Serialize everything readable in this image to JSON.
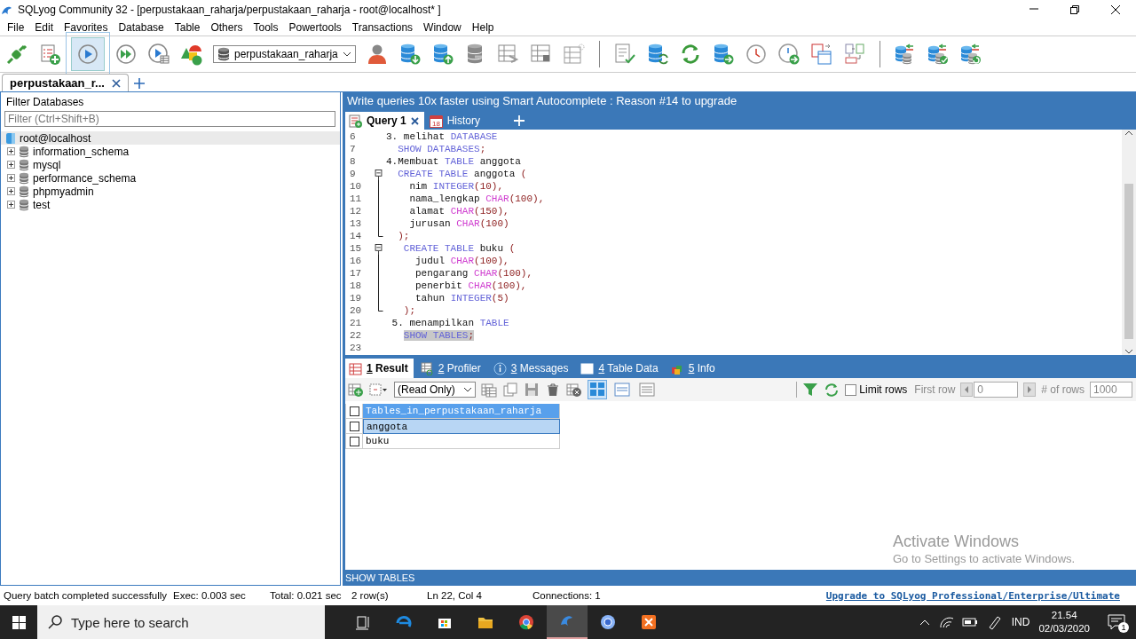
{
  "window": {
    "title": "SQLyog Community 32 - [perpustakaan_raharja/perpustakaan_raharja - root@localhost* ]"
  },
  "menu": [
    "File",
    "Edit",
    "Favorites",
    "Database",
    "Table",
    "Others",
    "Tools",
    "Powertools",
    "Transactions",
    "Window",
    "Help"
  ],
  "toolbar": {
    "database": "perpustakaan_raharja"
  },
  "connection_tabs": [
    {
      "label": "perpustakaan_r...",
      "selected": true
    }
  ],
  "explorer": {
    "title": "Filter Databases",
    "filter": {
      "placeholder": "Filter (Ctrl+Shift+B)"
    },
    "tree": [
      {
        "label": "root@localhost",
        "selected": true,
        "children": [
          {
            "label": "information_schema",
            "expanded": false,
            "selected": false
          },
          {
            "label": "mysql",
            "expanded": false,
            "selected": false
          },
          {
            "label": "performance_schema",
            "expanded": false,
            "selected": false
          },
          {
            "label": "phpmyadmin",
            "expanded": false,
            "selected": false
          },
          {
            "label": "test",
            "expanded": false,
            "selected": false
          }
        ]
      }
    ]
  },
  "banner": "Write queries 10x faster using Smart Autocomplete : Reason #14 to upgrade",
  "query_tabs": [
    {
      "label": "Query 1",
      "selected": true,
      "closable": true
    },
    {
      "label": "History",
      "selected": false,
      "closable": false,
      "icon_text": "18"
    }
  ],
  "editor": {
    "lines": [
      {
        "number": "6",
        "tokens": [
          {
            "kind": "plain",
            "text": "3. melihat "
          },
          {
            "kind": "keyword",
            "text": "DATABASE"
          }
        ]
      },
      {
        "number": "7",
        "tokens": [
          {
            "kind": "keyword",
            "text": "  SHOW DATABASES"
          },
          {
            "kind": "punct",
            "text": ";"
          }
        ]
      },
      {
        "number": "8",
        "tokens": [
          {
            "kind": "plain",
            "text": "4.Membuat "
          },
          {
            "kind": "keyword",
            "text": "TABLE"
          },
          {
            "kind": "plain",
            "text": " anggota"
          }
        ]
      },
      {
        "number": "9",
        "kind": "opener",
        "tokens": [
          {
            "kind": "keyword",
            "text": "  CREATE TABLE"
          },
          {
            "kind": "plain",
            "text": " anggota "
          },
          {
            "kind": "punct",
            "text": "("
          }
        ]
      },
      {
        "number": "10",
        "kind": "inner",
        "tokens": [
          {
            "kind": "plain",
            "text": "    nim "
          },
          {
            "kind": "keyword",
            "text": "INTEGER"
          },
          {
            "kind": "punct",
            "text": "(10),"
          }
        ]
      },
      {
        "number": "11",
        "kind": "inner",
        "tokens": [
          {
            "kind": "plain",
            "text": "    nama_lengkap "
          },
          {
            "kind": "type",
            "text": "CHAR"
          },
          {
            "kind": "punct",
            "text": "(100),"
          }
        ]
      },
      {
        "number": "12",
        "kind": "inner",
        "tokens": [
          {
            "kind": "plain",
            "text": "    alamat "
          },
          {
            "kind": "type",
            "text": "CHAR"
          },
          {
            "kind": "punct",
            "text": "(150),"
          }
        ]
      },
      {
        "number": "13",
        "kind": "inner",
        "tokens": [
          {
            "kind": "plain",
            "text": "    jurusan "
          },
          {
            "kind": "type",
            "text": "CHAR"
          },
          {
            "kind": "punct",
            "text": "(100)"
          }
        ]
      },
      {
        "number": "14",
        "kind": "closer",
        "tokens": [
          {
            "kind": "punct",
            "text": "  );"
          }
        ]
      },
      {
        "number": "15",
        "kind": "opener",
        "tokens": [
          {
            "kind": "keyword",
            "text": "   CREATE TABLE"
          },
          {
            "kind": "plain",
            "text": " buku "
          },
          {
            "kind": "punct",
            "text": "("
          }
        ]
      },
      {
        "number": "16",
        "kind": "inner",
        "tokens": [
          {
            "kind": "plain",
            "text": "     judul "
          },
          {
            "kind": "type",
            "text": "CHAR"
          },
          {
            "kind": "punct",
            "text": "(100),"
          }
        ]
      },
      {
        "number": "17",
        "kind": "inner",
        "tokens": [
          {
            "kind": "plain",
            "text": "     pengarang "
          },
          {
            "kind": "type",
            "text": "CHAR"
          },
          {
            "kind": "punct",
            "text": "(100),"
          }
        ]
      },
      {
        "number": "18",
        "kind": "inner",
        "tokens": [
          {
            "kind": "plain",
            "text": "     penerbit "
          },
          {
            "kind": "type",
            "text": "CHAR"
          },
          {
            "kind": "punct",
            "text": "(100),"
          }
        ]
      },
      {
        "number": "19",
        "kind": "inner",
        "tokens": [
          {
            "kind": "plain",
            "text": "     tahun "
          },
          {
            "kind": "keyword",
            "text": "INTEGER"
          },
          {
            "kind": "punct",
            "text": "(5)"
          }
        ]
      },
      {
        "number": "20",
        "kind": "closer",
        "tokens": [
          {
            "kind": "punct",
            "text": "   );"
          }
        ]
      },
      {
        "number": "21",
        "tokens": [
          {
            "kind": "plain",
            "text": " 5. menampilkan "
          },
          {
            "kind": "keyword",
            "text": "TABLE"
          }
        ]
      },
      {
        "number": "22",
        "tokens": [
          {
            "kind": "keyword",
            "text": "   SHOW TABLES",
            "selected": true
          },
          {
            "kind": "punct",
            "text": ";",
            "selected": true
          }
        ]
      },
      {
        "number": "23"
      }
    ]
  },
  "result_tabs": [
    {
      "key": "1",
      "label": "Result",
      "selected": true
    },
    {
      "key": "2",
      "label": "Profiler",
      "selected": false
    },
    {
      "key": "3",
      "label": "Messages",
      "selected": false
    },
    {
      "key": "4",
      "label": "Table Data",
      "selected": false
    },
    {
      "key": "5",
      "label": "Info",
      "selected": false
    }
  ],
  "result_toolbar": {
    "mode": "(Read Only)",
    "views": [
      {
        "selected": true
      },
      {
        "selected": false
      },
      {
        "selected": false
      }
    ],
    "limit_rows": {
      "label": "Limit rows",
      "checked": false
    },
    "first_row": {
      "label": "First row",
      "value": "0"
    },
    "row_count": {
      "label": "# of rows",
      "value": "1000"
    }
  },
  "grid": {
    "select_all": {
      "checked": false
    },
    "columns": [
      "Tables_in_perpustakaan_raharja"
    ],
    "rows": [
      {
        "cells": [
          "anggota"
        ],
        "selected": true,
        "checked": false
      },
      {
        "cells": [
          "buku"
        ],
        "selected": false,
        "checked": false
      }
    ]
  },
  "sql_bar": "SHOW TABLES",
  "status_bar": {
    "items": [
      "Query batch completed successfully",
      "Exec: 0.003 sec",
      "Total: 0.021 sec",
      "2 row(s)",
      "Ln 22, Col 4",
      "Connections: 1"
    ],
    "link": "Upgrade to SQLyog Professional/Enterprise/Ultimate"
  },
  "activation": {
    "title": "Activate Windows",
    "text": "Go to Settings to activate Windows."
  },
  "taskbar": {
    "search": {
      "placeholder": "Type here to search"
    },
    "apps": [
      {
        "selected": false
      },
      {
        "selected": false
      },
      {
        "selected": false
      },
      {
        "selected": false
      },
      {
        "selected": false
      },
      {
        "selected": true
      },
      {
        "selected": false
      },
      {
        "selected": false
      }
    ],
    "language": "IND",
    "time": "21.54",
    "date": "02/03/2020",
    "notifications": "1"
  }
}
